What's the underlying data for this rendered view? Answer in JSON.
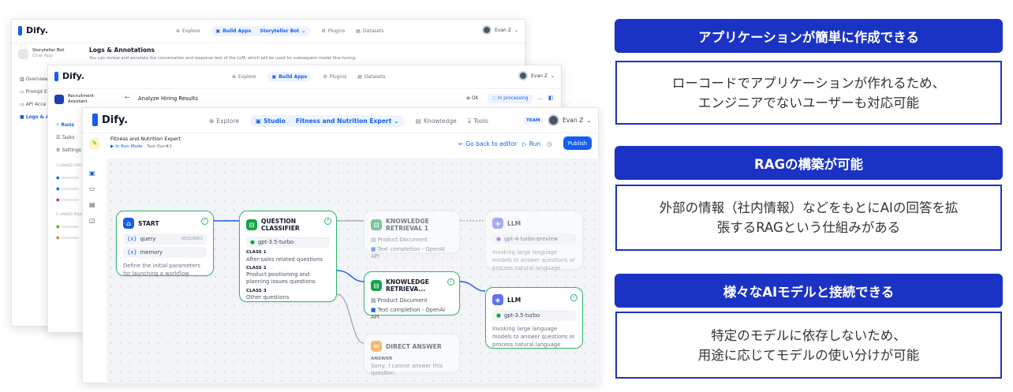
{
  "colors": {
    "accent": "#155eef",
    "feature_blue": "#1b33c4",
    "success": "#33b36f"
  },
  "win1": {
    "logo": "Dify.",
    "nav": {
      "explore": "Explore",
      "build_apps": "Build Apps",
      "app": "Storyteller Bot",
      "plugins": "Plugins",
      "datasets": "Datasets"
    },
    "user": "Evan Z",
    "app_name": "Storyteller Bot",
    "app_type": "Chat App",
    "page_title": "Logs & Annotations",
    "page_desc": "You can review and annotate the conversation and response text of the LLM, which will be used for subsequent model fine-tuning.",
    "side": [
      "Overview",
      "Prompt E",
      "API Acce",
      "Logs & A"
    ]
  },
  "win2": {
    "logo": "Dify.",
    "nav": {
      "explore": "Explore",
      "build_apps": "Build Apps",
      "plugins": "Plugins",
      "datasets": "Datasets"
    },
    "user": "Evan Z",
    "app_name": "Recruitment Assistant",
    "page_title": "Analyze Hiring Results",
    "status_ok": "OK",
    "status_proc": "In processing",
    "side": {
      "runs": "Runs",
      "tasks": "Tasks",
      "settings": "Settings",
      "linked_tools": "3 LINKED TOOLS",
      "linked_plugins": "2 LINKED PLUGINS"
    }
  },
  "win3": {
    "logo": "Dify.",
    "nav": {
      "explore": "Explore",
      "studio": "Studio",
      "app": "Fitness and Nutrition Expert",
      "knowledge": "Knowledge",
      "tools": "Tools"
    },
    "team": "TEAM",
    "user": "Evan Z",
    "app_name": "Fitness and Nutrition Expert",
    "run_mode": "In Run Mode",
    "test_run": "Test Run#2",
    "back": "Go back to editor",
    "run": "Run",
    "publish": "Publish",
    "nodes": {
      "start": {
        "title": "START",
        "var1": "query",
        "req": "REQUIRED",
        "var2": "memory",
        "desc": "Define the initial parameters for launching a workflow"
      },
      "qc": {
        "title": "QUESTION CLASSIFIER",
        "model": "gpt-3.5-turbo",
        "c1": "CLASS 1",
        "c1t": "After-sales related questions",
        "c2": "CLASS 2",
        "c2t": "Product positioning and planning issues questions",
        "c3": "CLASS 3",
        "c3t": "Other questions"
      },
      "kr1": {
        "title": "KNOWLEDGE RETRIEVAL 1",
        "r1": "Product Document",
        "r2": "Text completion - OpenAI API"
      },
      "llm1": {
        "title": "LLM",
        "model": "gpt-4-turbo-preview",
        "desc": "Invoking large language models to answer questions or process natural language"
      },
      "kr2": {
        "title": "KNOWLEDGE RETRIEVA...",
        "r1": "Product Document",
        "r2": "Text completion - OpenAI API"
      },
      "llm2": {
        "title": "LLM",
        "model": "gpt-3.5-turbo",
        "desc": "Invoking large language models to answer questions or process natural language"
      },
      "da": {
        "title": "DIRECT ANSWER",
        "label": "ANSWER",
        "text": "Sorry, I cannot answer this question."
      }
    }
  },
  "features": [
    {
      "title": "アプリケーションが簡単に作成できる",
      "lines": [
        "ローコードでアプリケーションが作れるため、",
        "エンジニアでないユーザーも対応可能"
      ]
    },
    {
      "title": "RAGの構築が可能",
      "lines": [
        "外部の情報（社内情報）などをもとにAIの回答を拡",
        "張するRAGという仕組みがある"
      ]
    },
    {
      "title": "様々なAIモデルと接続できる",
      "lines": [
        "特定のモデルに依存しないため、",
        "用途に応じてモデルの使い分けが可能"
      ]
    }
  ]
}
